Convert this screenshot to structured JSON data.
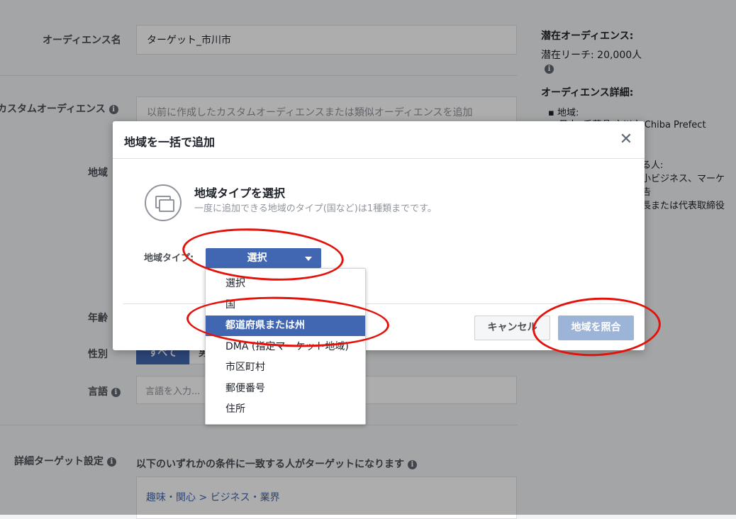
{
  "background": {
    "audience_name_label": "オーディエンス名",
    "audience_name_value": "ターゲット_市川市",
    "custom_audience_label": "カスタムオーディエンス",
    "custom_audience_placeholder": "以前に作成したカスタムオーディエンスまたは類似オーディエンスを追加",
    "location_label": "地域",
    "age_label": "年齢",
    "gender_label": "性別",
    "gender_all": "すべて",
    "gender_partial": "男",
    "language_label": "言語",
    "language_placeholder": "言語を入力...",
    "detailed_targeting_label": "詳細ターゲット設定",
    "detailed_targeting_desc": "以下のいずれかの条件に一致する人がターゲットになります",
    "detailed_targeting_value": "趣味・関心 > ビジネス・業界"
  },
  "sidebar": {
    "potential_audience_title": "潜在オーディエンス:",
    "potential_reach": "潜在リーチ: 20,000人",
    "audience_details_title": "オーディエンス詳細:",
    "location_item": "地域:",
    "location_value": "日本: 千葉県 市川市 Chiba Prefect",
    "partial_1": "る人:",
    "partial_2": "小ビジネス、マーケ",
    "partial_3": "告",
    "partial_4": "長または代表取締役"
  },
  "dialog": {
    "title": "地域を一括で追加",
    "close_glyph": "✕",
    "select_type_title": "地域タイプを選択",
    "select_type_sub": "一度に追加できる地域のタイプ(国など)は1種類までです。",
    "type_label": "地域タイプ:",
    "type_select_value": "選択",
    "cancel_label": "キャンセル",
    "match_label": "地域を照合"
  },
  "dropdown": {
    "options": [
      "選択",
      "国",
      "都道府県または州",
      "DMA (指定マーケット地域)",
      "市区町村",
      "郵便番号",
      "住所"
    ],
    "selected": "都道府県または州"
  },
  "colors": {
    "accent": "#4267b2",
    "annotation": "#e3120b",
    "disabled_button": "#9cb4d8"
  }
}
